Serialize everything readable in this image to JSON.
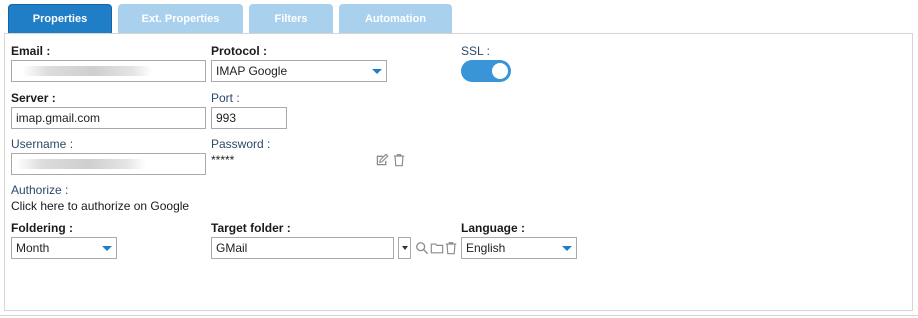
{
  "tabs": [
    {
      "label": "Properties",
      "active": true
    },
    {
      "label": "Ext. Properties",
      "active": false
    },
    {
      "label": "Filters",
      "active": false
    },
    {
      "label": "Automation",
      "active": false
    }
  ],
  "form": {
    "email_label": "Email :",
    "protocol_label": "Protocol :",
    "protocol_value": "IMAP Google",
    "ssl_label": "SSL :",
    "ssl_on": true,
    "server_label": "Server :",
    "server_value": "imap.gmail.com",
    "port_label": "Port :",
    "port_value": "993",
    "username_label": "Username :",
    "password_label": "Password :",
    "password_value": "*****",
    "authorize_label": "Authorize :",
    "authorize_link": "Click here to authorize on Google",
    "foldering_label": "Foldering :",
    "foldering_value": "Month",
    "target_folder_label": "Target folder :",
    "target_folder_value": "GMail",
    "language_label": "Language :",
    "language_value": "English"
  },
  "icons": {
    "edit": "edit-icon",
    "trash": "trash-icon",
    "search": "search-icon",
    "folder": "folder-icon"
  },
  "colors": {
    "accent": "#1f7ec6",
    "tab_inactive": "#a9d1ee",
    "toggle_on": "#3a94d8"
  }
}
